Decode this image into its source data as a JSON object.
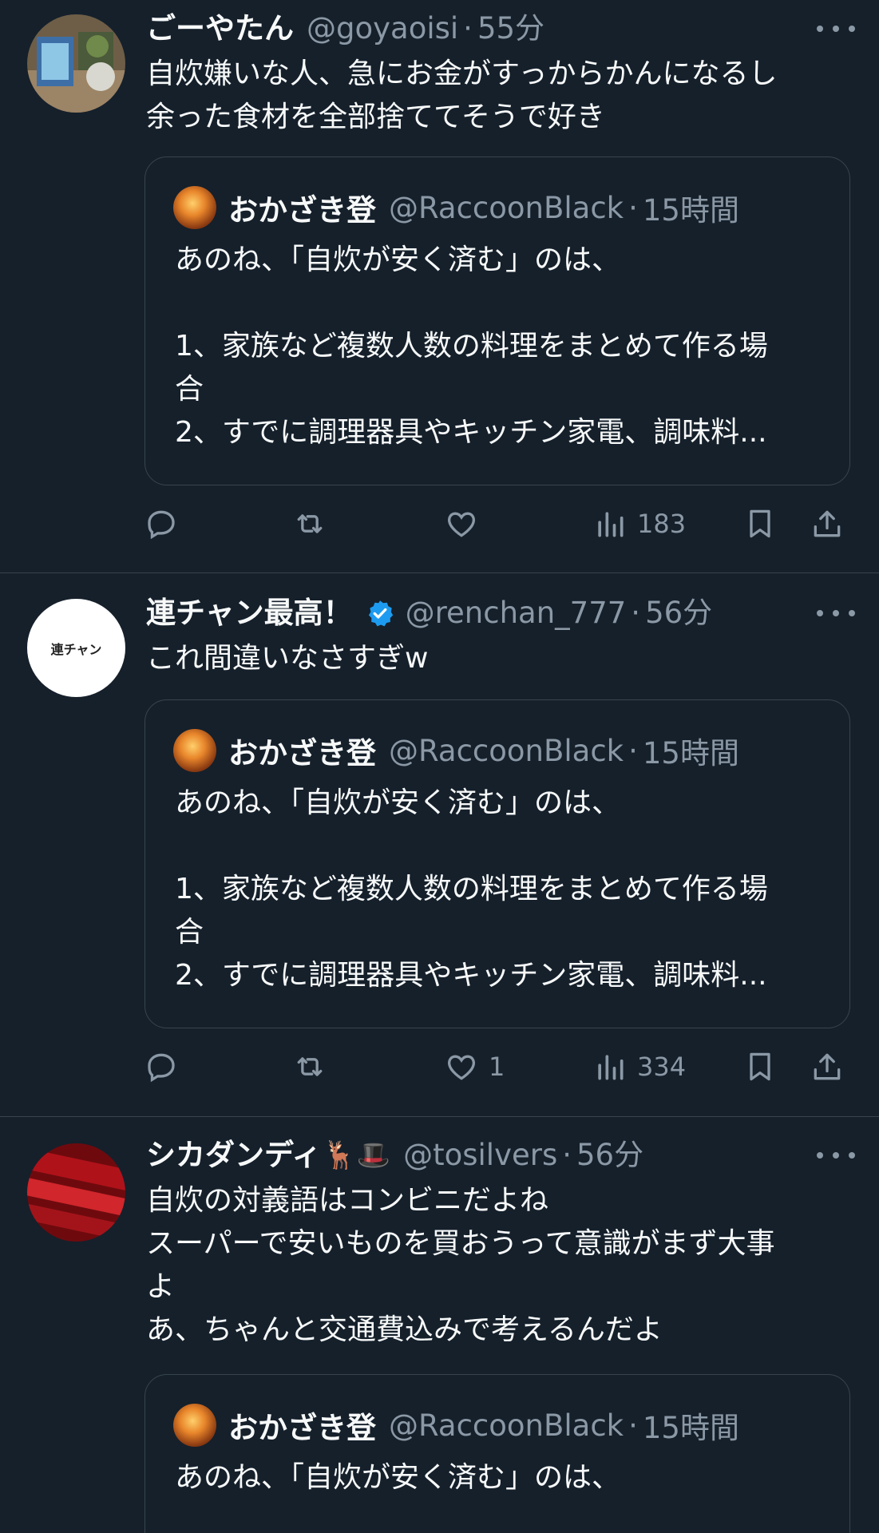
{
  "posts": [
    {
      "name": "ごーやたん",
      "handle": "@goyaoisi",
      "time": "55分",
      "text": "自炊嫌いな人、急にお金がすっからかんになるし\n余った食材を全部捨ててそうで好き",
      "quote": {
        "name": "おかざき登",
        "handle": "@RaccoonBlack",
        "time": "15時間",
        "text": "あのね、「自炊が安く済む」のは、\n\n1、家族など複数人数の料理をまとめて作る場\n合\n2、すでに調理器具やキッチン家電、調味料..."
      },
      "actions": {
        "reply": "",
        "retweet": "",
        "like": "",
        "views": "183"
      }
    },
    {
      "name": "連チャン最高！",
      "handle": "@renchan_777",
      "time": "56分",
      "avatar_text": "連チャン",
      "text": "これ間違いなさすぎw",
      "quote": {
        "name": "おかざき登",
        "handle": "@RaccoonBlack",
        "time": "15時間",
        "text": "あのね、「自炊が安く済む」のは、\n\n1、家族など複数人数の料理をまとめて作る場\n合\n2、すでに調理器具やキッチン家電、調味料..."
      },
      "actions": {
        "reply": "",
        "retweet": "",
        "like": "1",
        "views": "334"
      }
    },
    {
      "name": "シカダンディ",
      "name_emojis": "🦌🎩",
      "handle": "@tosilvers",
      "time": "56分",
      "text": "自炊の対義語はコンビニだよね\nスーパーで安いものを買おうって意識がまず大事\nよ\nあ、ちゃんと交通費込みで考えるんだよ",
      "quote": {
        "name": "おかざき登",
        "handle": "@RaccoonBlack",
        "time": "15時間",
        "text": "あのね、「自炊が安く済む」のは、"
      }
    }
  ],
  "separator": "·",
  "colors": {
    "background": "#15202b",
    "text": "#f7f9f9",
    "muted": "#8b98a5",
    "border": "#38444d",
    "verified": "#1d9bf0"
  },
  "icons": [
    "more-icon",
    "reply-icon",
    "retweet-icon",
    "like-icon",
    "views-icon",
    "bookmark-icon",
    "share-icon",
    "verified-badge-icon"
  ]
}
